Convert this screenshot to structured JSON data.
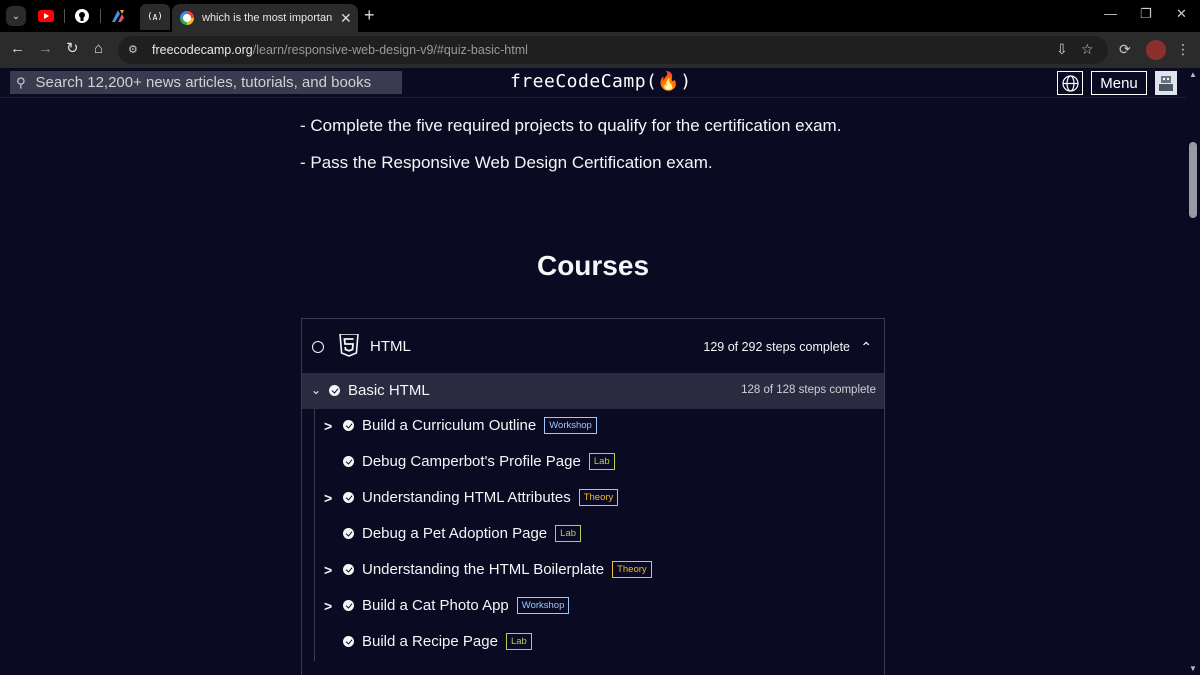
{
  "browser": {
    "active_tab_title": "which is the most important he",
    "new_tab_symbol": "+",
    "close_symbol": "✕",
    "url_host": "freecodecamp.org",
    "url_path": "/learn/responsive-web-design-v9/#quiz-basic-html"
  },
  "fcc_nav": {
    "search_placeholder": "Search 12,200+ news articles, tutorials, and books",
    "logo_text": "freeCodeCamp(🔥)",
    "menu_label": "Menu"
  },
  "content": {
    "requirements": [
      "- Complete the five required projects to qualify for the certification exam.",
      "- Pass the Responsive Web Design Certification exam."
    ],
    "courses_heading": "Courses"
  },
  "course": {
    "title": "HTML",
    "progress": "129 of 292 steps complete",
    "block": {
      "title": "Basic HTML",
      "progress": "128 of 128 steps complete",
      "steps": [
        {
          "title": "Build a Curriculum Outline",
          "badge": "Workshop"
        },
        {
          "title": "Debug Camperbot's Profile Page",
          "badge": "Lab"
        },
        {
          "title": "Understanding HTML Attributes",
          "badge": "Theory"
        },
        {
          "title": "Debug a Pet Adoption Page",
          "badge": "Lab"
        },
        {
          "title": "Understanding the HTML Boilerplate",
          "badge": "Theory"
        },
        {
          "title": "Build a Cat Photo App",
          "badge": "Workshop"
        },
        {
          "title": "Build a Recipe Page",
          "badge": "Lab"
        }
      ]
    }
  },
  "colors": {
    "page_bg": "#0a0a23",
    "block_bg": "#2a2a40",
    "workshop": "#99c9ff",
    "lab": "#acd157",
    "theory": "#f1be32"
  }
}
